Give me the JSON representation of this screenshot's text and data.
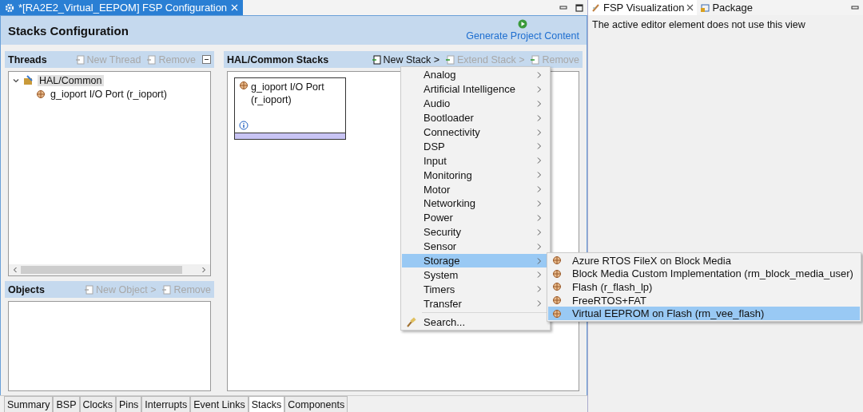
{
  "editor_tab": {
    "title": "*[RA2E2_Virtual_EEPOM] FSP Configuration",
    "selected": true
  },
  "header": {
    "title": "Stacks Configuration",
    "action": "Generate Project Content"
  },
  "threads": {
    "title": "Threads",
    "buttons": [
      {
        "label": "New Thread",
        "disabled": true
      },
      {
        "label": "Remove",
        "disabled": true
      }
    ],
    "tree": [
      {
        "label": "HAL/Common",
        "expanded": true,
        "selected": true,
        "children": [
          {
            "label": "g_ioport I/O Port (r_ioport)",
            "selected": false
          }
        ]
      }
    ]
  },
  "objects": {
    "title": "Objects",
    "buttons": [
      {
        "label": "New Object >",
        "disabled": true
      },
      {
        "label": "Remove",
        "disabled": true
      }
    ]
  },
  "stacks": {
    "title": "HAL/Common Stacks",
    "buttons": [
      {
        "label": "New Stack >",
        "disabled": false
      },
      {
        "label": "Extend Stack >",
        "disabled": true
      },
      {
        "label": "Remove",
        "disabled": true
      }
    ],
    "modules": [
      {
        "name": "g_ioport I/O Port (r_ioport)"
      }
    ]
  },
  "menu": {
    "items": [
      {
        "label": "Analog",
        "selected": false
      },
      {
        "label": "Artificial Intelligence",
        "selected": false
      },
      {
        "label": "Audio",
        "selected": false
      },
      {
        "label": "Bootloader",
        "selected": false
      },
      {
        "label": "Connectivity",
        "selected": false
      },
      {
        "label": "DSP",
        "selected": false
      },
      {
        "label": "Input",
        "selected": false
      },
      {
        "label": "Monitoring",
        "selected": false
      },
      {
        "label": "Motor",
        "selected": false
      },
      {
        "label": "Networking",
        "selected": false
      },
      {
        "label": "Power",
        "selected": false
      },
      {
        "label": "Security",
        "selected": false
      },
      {
        "label": "Sensor",
        "selected": false
      },
      {
        "label": "Storage",
        "selected": true
      },
      {
        "label": "System",
        "selected": false
      },
      {
        "label": "Timers",
        "selected": false
      },
      {
        "label": "Transfer",
        "selected": false
      }
    ],
    "search": "Search..."
  },
  "submenu": {
    "items": [
      {
        "label": "Azure RTOS FileX on Block Media",
        "selected": false
      },
      {
        "label": "Block Media Custom Implementation (rm_block_media_user)",
        "selected": false
      },
      {
        "label": "Flash (r_flash_lp)",
        "selected": false
      },
      {
        "label": "FreeRTOS+FAT",
        "selected": false
      },
      {
        "label": "Virtual EEPROM on Flash (rm_vee_flash)",
        "selected": true
      }
    ]
  },
  "bottom_tabs": [
    {
      "label": "Summary",
      "selected": false
    },
    {
      "label": "BSP",
      "selected": false
    },
    {
      "label": "Clocks",
      "selected": false
    },
    {
      "label": "Pins",
      "selected": false
    },
    {
      "label": "Interrupts",
      "selected": false
    },
    {
      "label": "Event Links",
      "selected": false
    },
    {
      "label": "Stacks",
      "selected": true
    },
    {
      "label": "Components",
      "selected": false
    }
  ],
  "side_view": {
    "tabs": [
      {
        "label": "FSP Visualization",
        "selected": true
      },
      {
        "label": "Package",
        "selected": false
      }
    ],
    "message": "The active editor element does not use this view"
  }
}
